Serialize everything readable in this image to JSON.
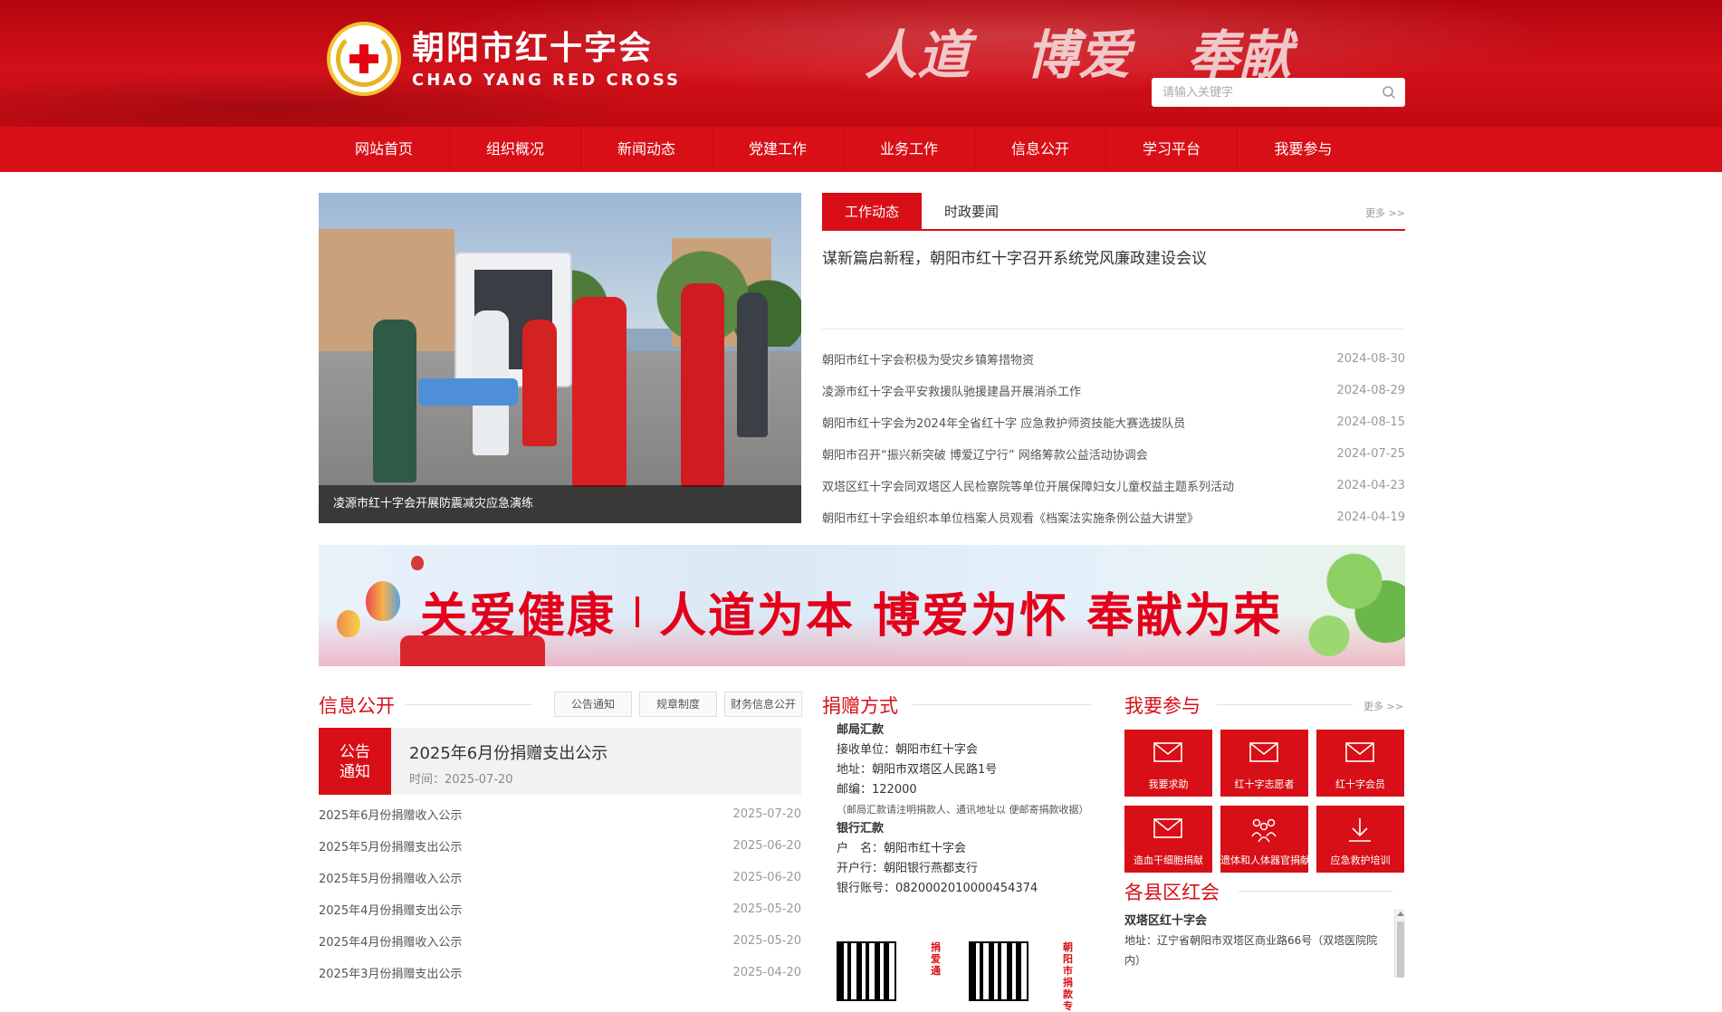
{
  "header": {
    "site_name_cn": "朝阳市红十字会",
    "site_name_en": "CHAO YANG RED CROSS",
    "slogan": [
      "人道",
      "博爱",
      "奉献"
    ],
    "search_placeholder": "请输入关键字"
  },
  "nav": {
    "items": [
      "网站首页",
      "组织概况",
      "新闻动态",
      "党建工作",
      "业务工作",
      "信息公开",
      "学习平台",
      "我要参与"
    ]
  },
  "hero": {
    "caption": "凌源市红十字会开展防震减灾应急演练"
  },
  "news": {
    "tab_active": "工作动态",
    "tab_other": "时政要闻",
    "more": "更多 >>",
    "headline": "谋新篇启新程，朝阳市红十字召开系统党风廉政建设会议",
    "items": [
      {
        "title": "朝阳市红十字会积极为受灾乡镇筹措物资",
        "date": "2024-08-30"
      },
      {
        "title": "凌源市红十字会平安救援队驰援建昌开展消杀工作",
        "date": "2024-08-29"
      },
      {
        "title": "朝阳市红十字会为2024年全省红十字 应急救护师资技能大赛选拔队员",
        "date": "2024-08-15"
      },
      {
        "title": "朝阳市召开“振兴新突破 博爱辽宁行” 网络筹款公益活动协调会",
        "date": "2024-07-25"
      },
      {
        "title": "双塔区红十字会同双塔区人民检察院等单位开展保障妇女儿童权益主题系列活动",
        "date": "2024-04-23"
      },
      {
        "title": "朝阳市红十字会组织本单位档案人员观看《档案法实施条例公益大讲堂》",
        "date": "2024-04-19"
      }
    ]
  },
  "banner": {
    "text1": "关爱健康",
    "text2": "人道为本 博爱为怀 奉献为荣"
  },
  "info": {
    "title": "信息公开",
    "tabs": [
      "公告通知",
      "规章制度",
      "财务信息公开"
    ],
    "notice_badge": [
      "公告",
      "通知"
    ],
    "notice_title": "2025年6月份捐赠支出公示",
    "notice_time": "时间：2025-07-20",
    "items": [
      {
        "title": "2025年6月份捐赠收入公示",
        "date": "2025-07-20"
      },
      {
        "title": "2025年5月份捐赠支出公示",
        "date": "2025-06-20"
      },
      {
        "title": "2025年5月份捐赠收入公示",
        "date": "2025-06-20"
      },
      {
        "title": "2025年4月份捐赠支出公示",
        "date": "2025-05-20"
      },
      {
        "title": "2025年4月份捐赠收入公示",
        "date": "2025-05-20"
      },
      {
        "title": "2025年3月份捐赠支出公示",
        "date": "2025-04-20"
      }
    ]
  },
  "donation": {
    "title": "捐赠方式",
    "postal_head": "邮局汇款",
    "postal_lines": [
      "接收单位：朝阳市红十字会",
      "地址：朝阳市双塔区人民路1号",
      "邮编：122000"
    ],
    "postal_note": "（邮局汇款请注明捐款人、通讯地址以 便邮寄捐款收据）",
    "bank_head": "银行汇款",
    "bank_lines": [
      "户　名：朝阳市红十字会",
      "开户行：朝阳银行燕都支行",
      "银行账号：0820002010000454374"
    ],
    "qr1_label": "捐爱通",
    "qr2_label": "朝阳市捐款专"
  },
  "participate": {
    "title": "我要参与",
    "more": "更多 >>",
    "buttons": [
      "我要求助",
      "红十字志愿者",
      "红十字会员",
      "造血干细胞捐献",
      "遗体和人体器官捐献",
      "应急救护培训"
    ]
  },
  "county": {
    "title": "各县区红会",
    "name": "双塔区红十字会",
    "address": "地址：辽宁省朝阳市双塔区商业路66号（双塔医院院内）"
  },
  "colors": {
    "brand_red": "#d80f17",
    "header_red": "#c10a12"
  }
}
